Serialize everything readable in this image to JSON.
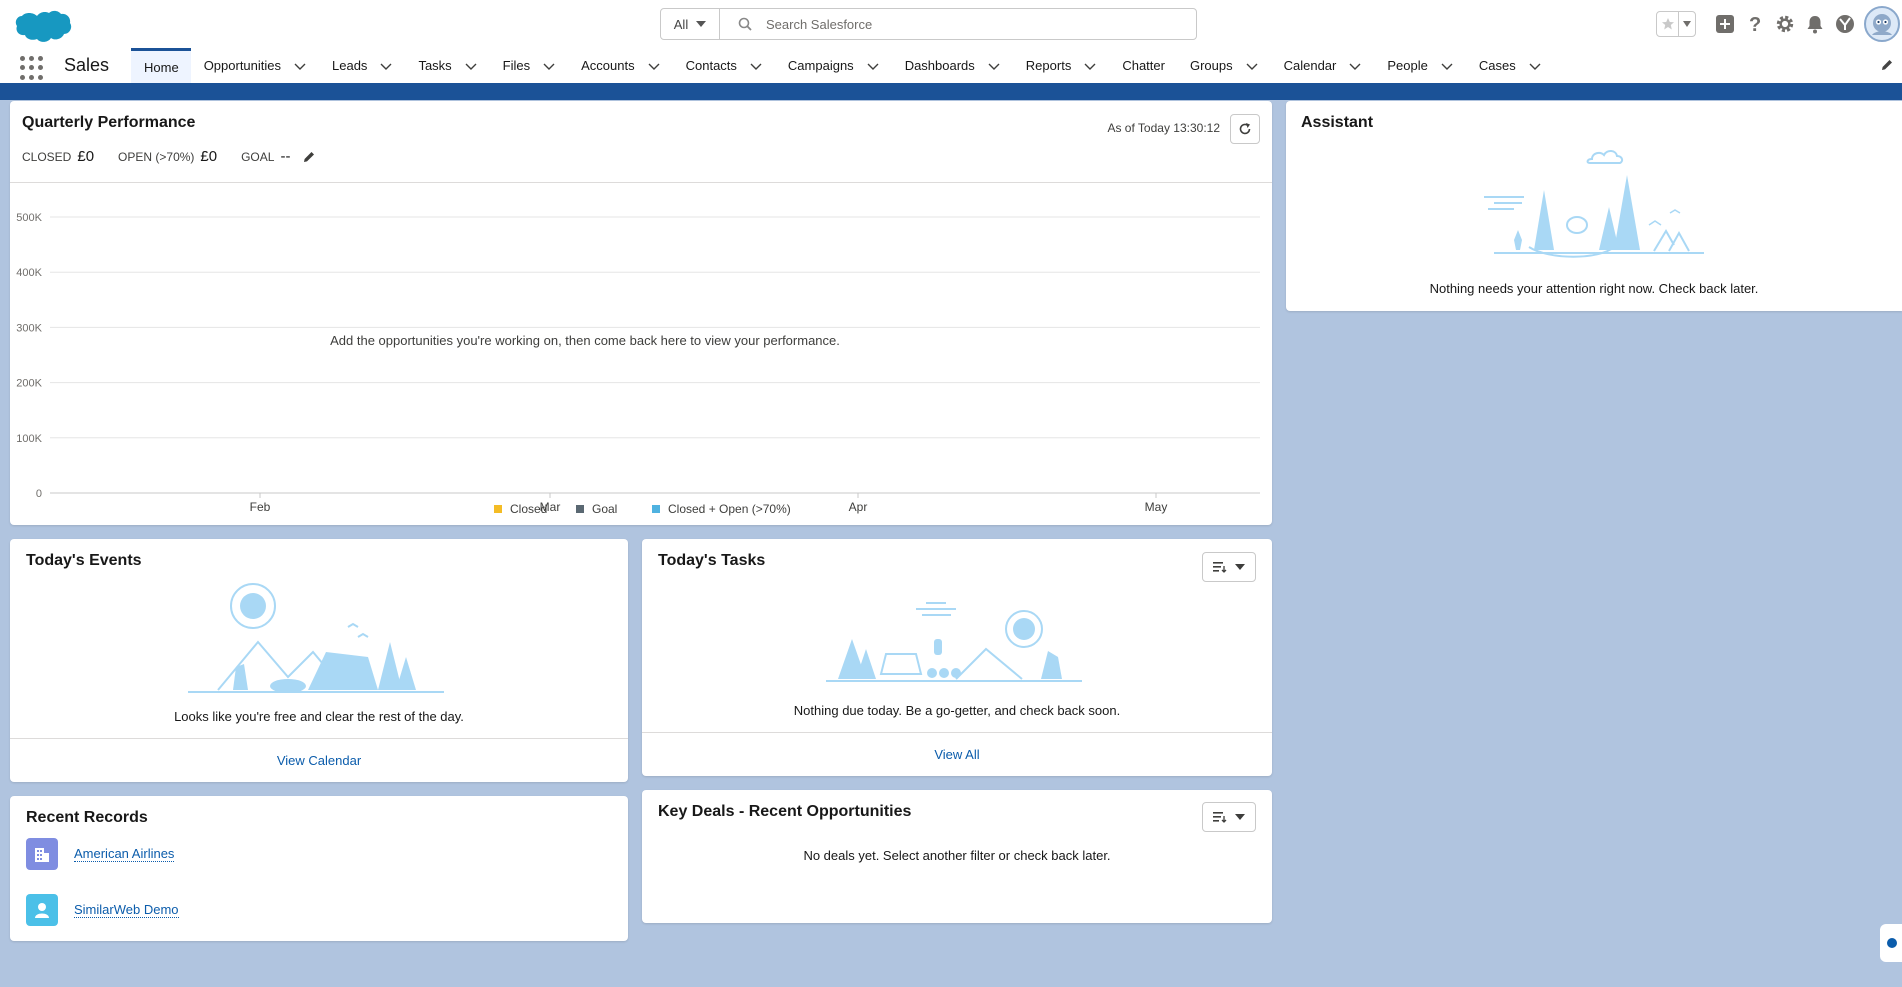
{
  "header": {
    "search_scope": "All",
    "search_placeholder": "Search Salesforce"
  },
  "nav": {
    "app_name": "Sales",
    "tabs": [
      {
        "label": "Home",
        "has_menu": false,
        "active": true
      },
      {
        "label": "Opportunities",
        "has_menu": true
      },
      {
        "label": "Leads",
        "has_menu": true
      },
      {
        "label": "Tasks",
        "has_menu": true
      },
      {
        "label": "Files",
        "has_menu": true
      },
      {
        "label": "Accounts",
        "has_menu": true
      },
      {
        "label": "Contacts",
        "has_menu": true
      },
      {
        "label": "Campaigns",
        "has_menu": true
      },
      {
        "label": "Dashboards",
        "has_menu": true
      },
      {
        "label": "Reports",
        "has_menu": true
      },
      {
        "label": "Chatter",
        "has_menu": false
      },
      {
        "label": "Groups",
        "has_menu": true
      },
      {
        "label": "Calendar",
        "has_menu": true
      },
      {
        "label": "People",
        "has_menu": true
      },
      {
        "label": "Cases",
        "has_menu": true
      }
    ]
  },
  "performance": {
    "title": "Quarterly Performance",
    "closed_label": "CLOSED",
    "closed_value": "£0",
    "open_label": "OPEN (>70%)",
    "open_value": "£0",
    "goal_label": "GOAL",
    "goal_value": "--",
    "as_of": "As of Today 13:30:12",
    "empty_message": "Add the opportunities you're working on, then come back here to view your performance."
  },
  "chart_data": {
    "type": "line",
    "x": [
      "Feb",
      "Mar",
      "Apr",
      "May"
    ],
    "y_ticks": [
      "0",
      "100K",
      "200K",
      "300K",
      "400K",
      "500K"
    ],
    "ylim": [
      0,
      500000
    ],
    "series": [
      {
        "name": "Closed",
        "color": "#f4bc25",
        "values": []
      },
      {
        "name": "Goal",
        "color": "#5a6872",
        "values": []
      },
      {
        "name": "Closed + Open (>70%)",
        "color": "#4fb2e0",
        "values": []
      }
    ],
    "legend": "bottom",
    "grid": true
  },
  "assistant": {
    "title": "Assistant",
    "message": "Nothing needs your attention right now. Check back later."
  },
  "events": {
    "title": "Today's Events",
    "message": "Looks like you're free and clear the rest of the day.",
    "footer_link": "View Calendar"
  },
  "tasks": {
    "title": "Today's Tasks",
    "message": "Nothing due today. Be a go-getter, and check back soon.",
    "footer_link": "View All"
  },
  "recent": {
    "title": "Recent Records",
    "items": [
      {
        "label": "American Airlines",
        "icon": "account-icon",
        "color": "#7f8de1"
      },
      {
        "label": "SimilarWeb Demo",
        "icon": "contact-icon",
        "color": "#4bc0e8"
      }
    ]
  },
  "deals": {
    "title": "Key Deals - Recent Opportunities",
    "message": "No deals yet. Select another filter or check back later."
  }
}
